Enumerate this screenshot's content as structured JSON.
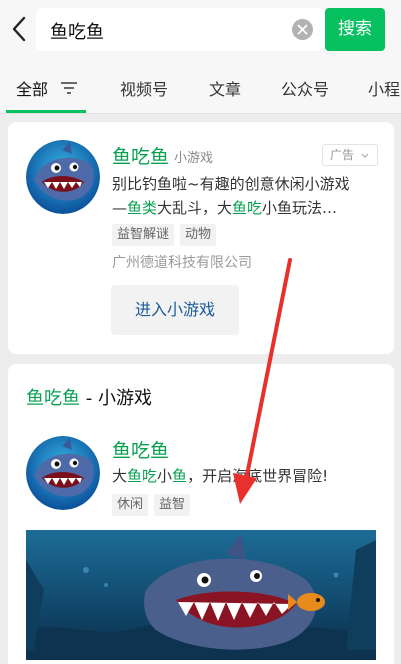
{
  "search": {
    "query": "鱼吃鱼",
    "button_label": "搜索"
  },
  "tabs": [
    {
      "label": "全部"
    },
    {
      "label": "视频号"
    },
    {
      "label": "文章"
    },
    {
      "label": "公众号"
    },
    {
      "label": "小程"
    }
  ],
  "card1": {
    "title": "鱼吃鱼",
    "type_label": "小游戏",
    "ad_label": "广告",
    "desc_line1": "别比钓鱼啦~有趣的创意休闲小游戏",
    "desc_line2_parts": [
      "—",
      "鱼类",
      "大乱斗，大",
      "鱼吃",
      "小鱼玩法…"
    ],
    "tags": [
      "益智解谜",
      "动物"
    ],
    "company": "广州德道科技有限公司",
    "enter_button": "进入小游戏"
  },
  "card2": {
    "heading_highlight": "鱼吃鱼",
    "heading_rest": " - 小游戏",
    "title": "鱼吃鱼",
    "desc_parts": [
      "大",
      "鱼吃",
      "小",
      "鱼",
      "，开启海底世界冒险!"
    ],
    "tags": [
      "休闲",
      "益智"
    ]
  },
  "colors": {
    "brand_green": "#07c160",
    "highlight_green": "#07a150",
    "arrow_red": "#e8312c"
  },
  "icons": [
    "back-icon",
    "clear-icon",
    "filter-icon",
    "chevron-down-icon"
  ]
}
